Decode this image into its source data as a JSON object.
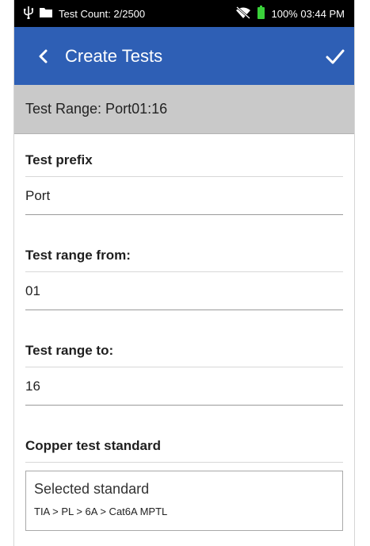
{
  "status_bar": {
    "test_count": "Test Count: 2/2500",
    "battery_time": "100% 03:44 PM",
    "icons": [
      "usb-icon",
      "folder-icon",
      "wifi-off-icon",
      "battery-icon"
    ]
  },
  "app_bar": {
    "title": "Create Tests",
    "back_icon": "chevron-left-icon",
    "confirm_icon": "check-icon"
  },
  "banner": {
    "text": "Test Range: Port01:16"
  },
  "form": {
    "prefix_label": "Test prefix",
    "prefix_value": "Port",
    "from_label": "Test range from:",
    "from_value": "01",
    "to_label": "Test range to:",
    "to_value": "16",
    "standard_label": "Copper test standard",
    "standard_title": "Selected standard",
    "standard_path": "TIA > PL > 6A > Cat6A MPTL"
  },
  "colors": {
    "app_bar": "#2e5fb5",
    "banner": "#c9c9c9",
    "battery": "#3ad13a"
  }
}
